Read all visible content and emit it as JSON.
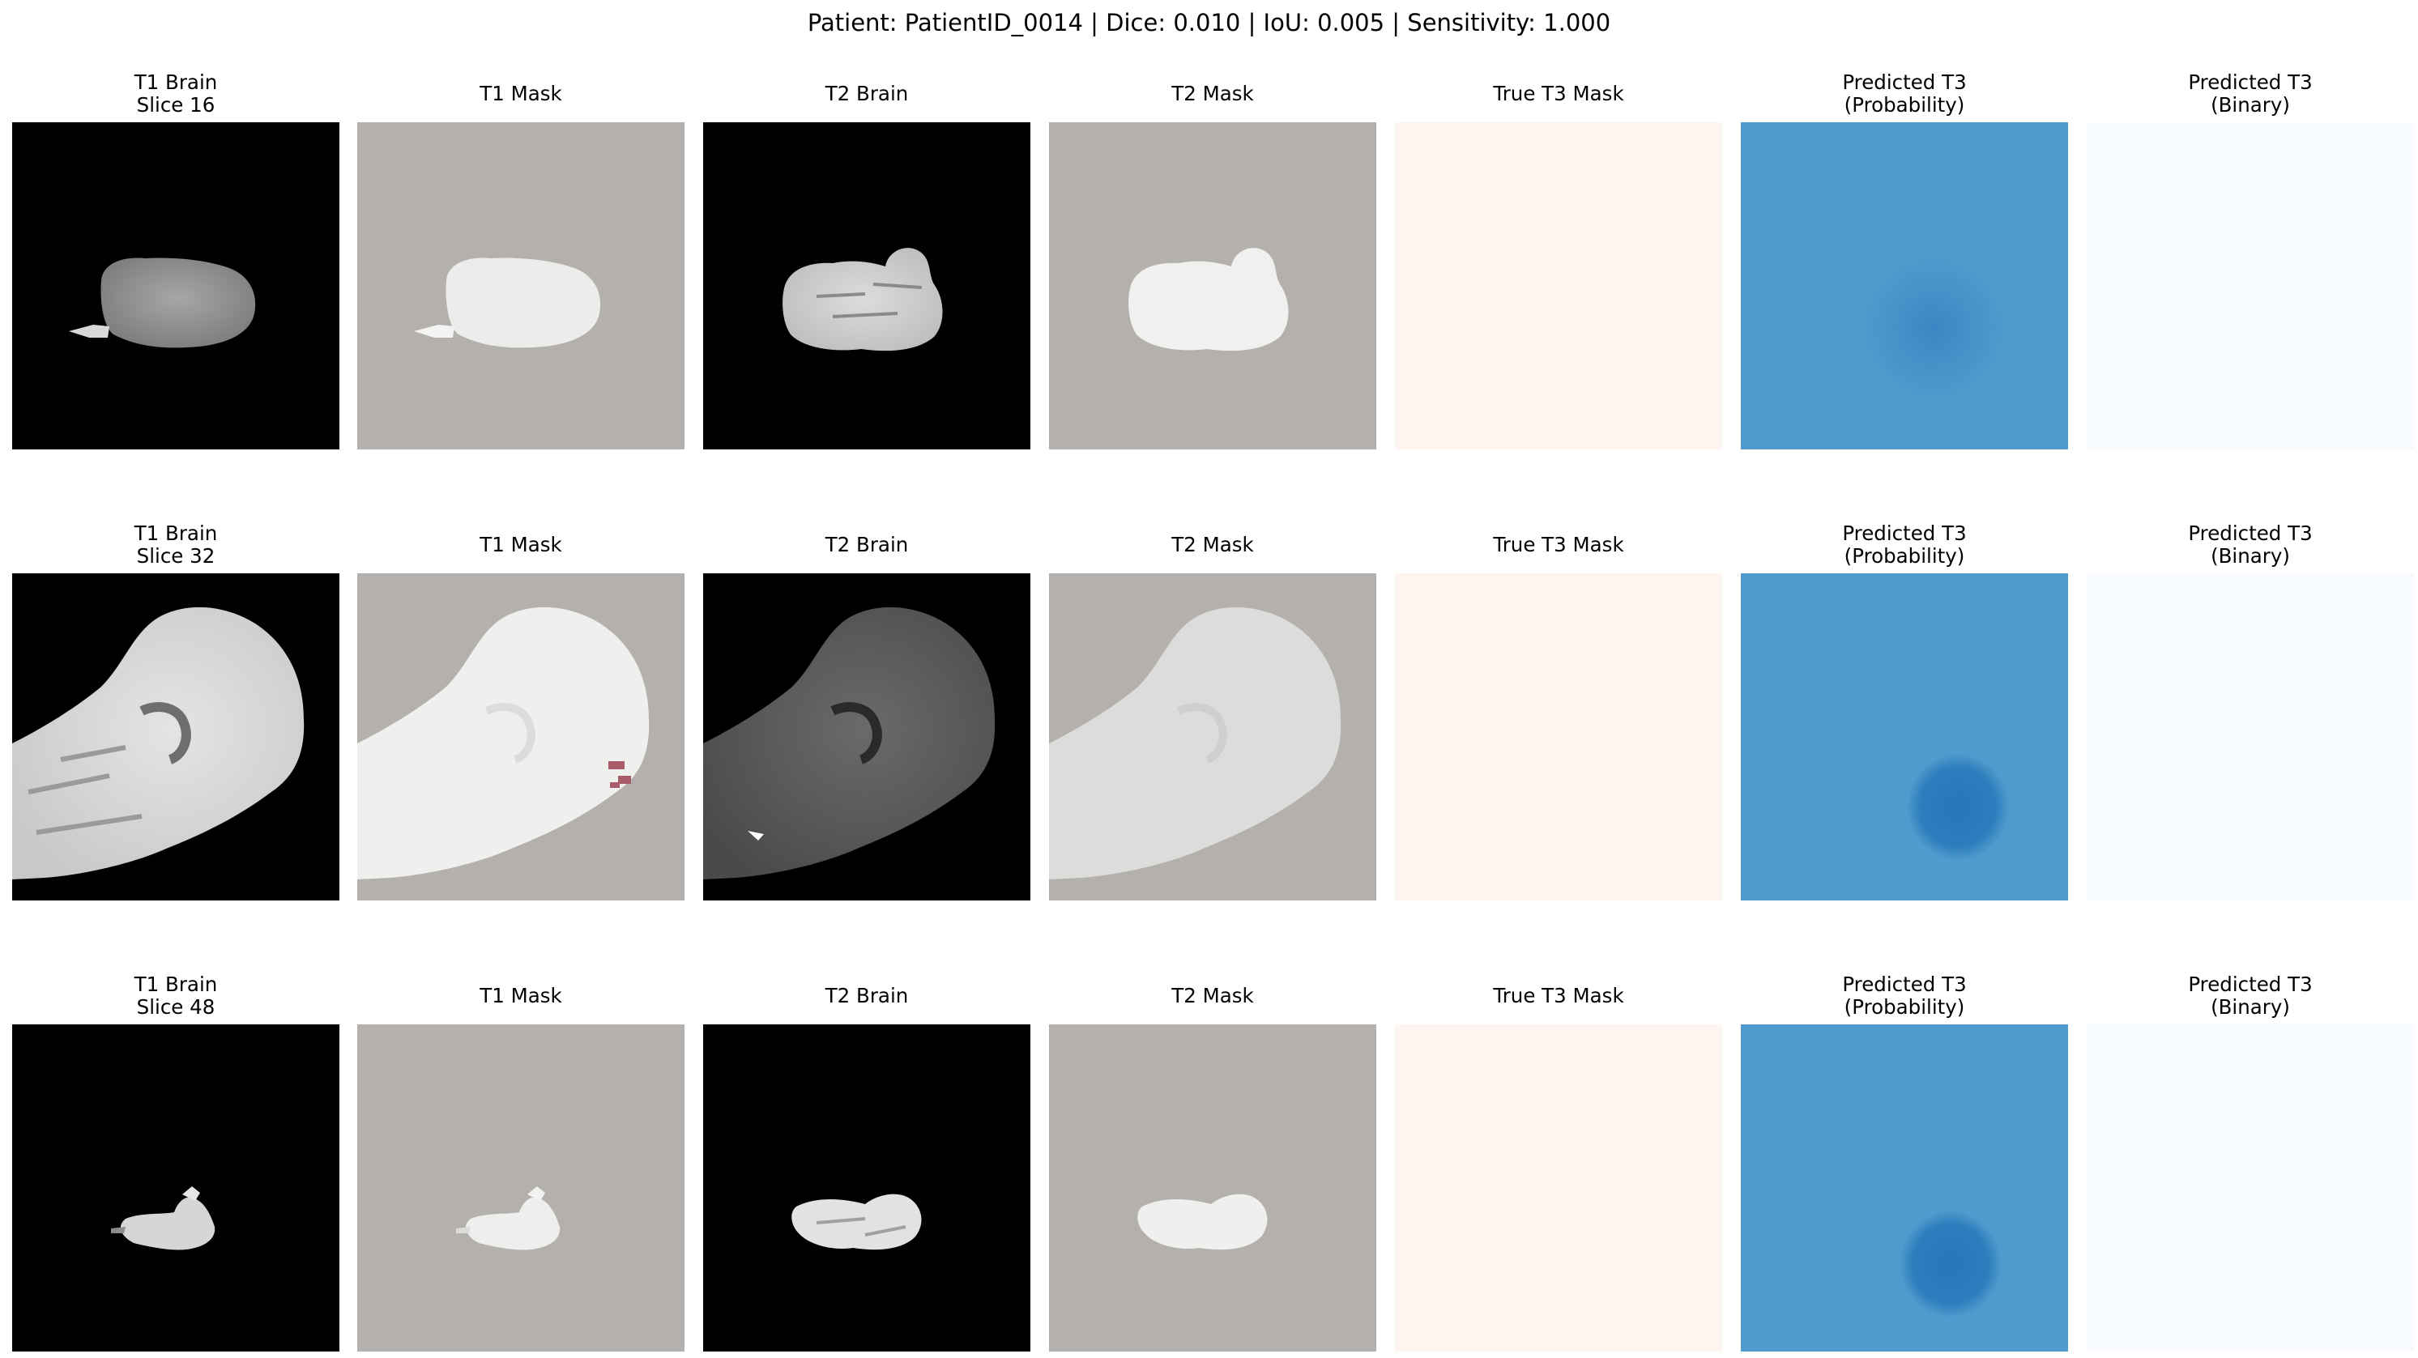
{
  "figure": {
    "suptitle": "Patient: PatientID_0014 | Dice: 0.010 | IoU: 0.005 | Sensitivity: 1.000"
  },
  "colors": {
    "brain_bg": "#000000",
    "mask_bg": "#b4b0ad",
    "true_mask_bg": "#fff5f0",
    "prob_bg": "#4f9bcd",
    "prob_blob": "#2f7dbe",
    "binary_bg": "#f7fbff",
    "lesion": "#a85c69"
  },
  "rows": [
    {
      "row_id": "slice-16",
      "panels": [
        {
          "kind": "t1-brain",
          "title_line1": "T1 Brain",
          "title_line2": "Slice 16"
        },
        {
          "kind": "t1-mask",
          "title_line1": "T1 Mask",
          "title_line2": ""
        },
        {
          "kind": "t2-brain",
          "title_line1": "T2 Brain",
          "title_line2": ""
        },
        {
          "kind": "t2-mask",
          "title_line1": "T2 Mask",
          "title_line2": ""
        },
        {
          "kind": "true-t3-mask",
          "title_line1": "True T3 Mask",
          "title_line2": ""
        },
        {
          "kind": "predicted-t3-probability",
          "title_line1": "Predicted T3",
          "title_line2": "(Probability)"
        },
        {
          "kind": "predicted-t3-binary",
          "title_line1": "Predicted T3",
          "title_line2": "(Binary)"
        }
      ]
    },
    {
      "row_id": "slice-32",
      "panels": [
        {
          "kind": "t1-brain",
          "title_line1": "T1 Brain",
          "title_line2": "Slice 32"
        },
        {
          "kind": "t1-mask",
          "title_line1": "T1 Mask",
          "title_line2": ""
        },
        {
          "kind": "t2-brain",
          "title_line1": "T2 Brain",
          "title_line2": ""
        },
        {
          "kind": "t2-mask",
          "title_line1": "T2 Mask",
          "title_line2": ""
        },
        {
          "kind": "true-t3-mask",
          "title_line1": "True T3 Mask",
          "title_line2": ""
        },
        {
          "kind": "predicted-t3-probability",
          "title_line1": "Predicted T3",
          "title_line2": "(Probability)"
        },
        {
          "kind": "predicted-t3-binary",
          "title_line1": "Predicted T3",
          "title_line2": "(Binary)"
        }
      ]
    },
    {
      "row_id": "slice-48",
      "panels": [
        {
          "kind": "t1-brain",
          "title_line1": "T1 Brain",
          "title_line2": "Slice 48"
        },
        {
          "kind": "t1-mask",
          "title_line1": "T1 Mask",
          "title_line2": ""
        },
        {
          "kind": "t2-brain",
          "title_line1": "T2 Brain",
          "title_line2": ""
        },
        {
          "kind": "t2-mask",
          "title_line1": "T2 Mask",
          "title_line2": ""
        },
        {
          "kind": "true-t3-mask",
          "title_line1": "True T3 Mask",
          "title_line2": ""
        },
        {
          "kind": "predicted-t3-probability",
          "title_line1": "Predicted T3",
          "title_line2": "(Probability)"
        },
        {
          "kind": "predicted-t3-binary",
          "title_line1": "Predicted T3",
          "title_line2": "(Binary)"
        }
      ]
    }
  ]
}
